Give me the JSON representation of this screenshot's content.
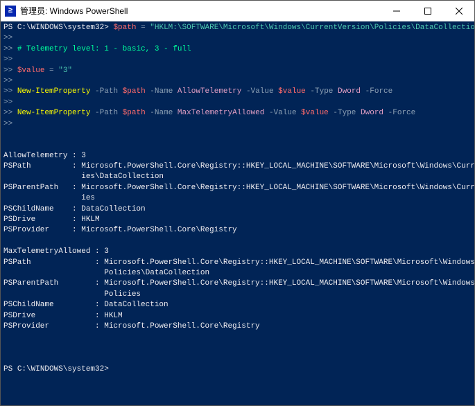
{
  "titlebar": {
    "title": "管理员: Windows PowerShell"
  },
  "prompt": {
    "ps": "PS",
    "path": "C:\\WINDOWS\\system32",
    "gt": ">"
  },
  "prompt2": ">>",
  "cmd1": {
    "var": "$path",
    "eq": " = ",
    "val": "\"HKLM:\\SOFTWARE\\Microsoft\\Windows\\CurrentVersion\\Policies\\DataCollection\""
  },
  "cmd2": "# Telemetry level: 1 - basic, 3 - full",
  "cmd3": {
    "var": "$value",
    "eq": " = ",
    "val": "\"3\""
  },
  "cmd4": {
    "cmdlet": "New-ItemProperty",
    "pPath": "-Path",
    "vPath": "$path",
    "pName": "-Name",
    "vName": "AllowTelemetry",
    "pValue": "-Value",
    "vValue": "$value",
    "pType": "-Type",
    "vType": "Dword",
    "pForce": "-Force"
  },
  "cmd5": {
    "cmdlet": "New-ItemProperty",
    "pPath": "-Path",
    "vPath": "$path",
    "pName": "-Name",
    "vName": "MaxTelemetryAllowed",
    "pValue": "-Value",
    "vValue": "$value",
    "pType": "-Type",
    "vType": "Dword",
    "pForce": "-Force"
  },
  "out1": {
    "l1": "AllowTelemetry : 3",
    "l2": "PSPath         : Microsoft.PowerShell.Core\\Registry::HKEY_LOCAL_MACHINE\\SOFTWARE\\Microsoft\\Windows\\CurrentVersion\\Polic",
    "l3": "                 ies\\DataCollection",
    "l4": "PSParentPath   : Microsoft.PowerShell.Core\\Registry::HKEY_LOCAL_MACHINE\\SOFTWARE\\Microsoft\\Windows\\CurrentVersion\\Polic",
    "l5": "                 ies",
    "l6": "PSChildName    : DataCollection",
    "l7": "PSDrive        : HKLM",
    "l8": "PSProvider     : Microsoft.PowerShell.Core\\Registry"
  },
  "out2": {
    "l1": "MaxTelemetryAllowed : 3",
    "l2": "PSPath              : Microsoft.PowerShell.Core\\Registry::HKEY_LOCAL_MACHINE\\SOFTWARE\\Microsoft\\Windows\\CurrentVersion\\",
    "l3": "                      Policies\\DataCollection",
    "l4": "PSParentPath        : Microsoft.PowerShell.Core\\Registry::HKEY_LOCAL_MACHINE\\SOFTWARE\\Microsoft\\Windows\\CurrentVersion\\",
    "l5": "                      Policies",
    "l6": "PSChildName         : DataCollection",
    "l7": "PSDrive             : HKLM",
    "l8": "PSProvider          : Microsoft.PowerShell.Core\\Registry"
  }
}
